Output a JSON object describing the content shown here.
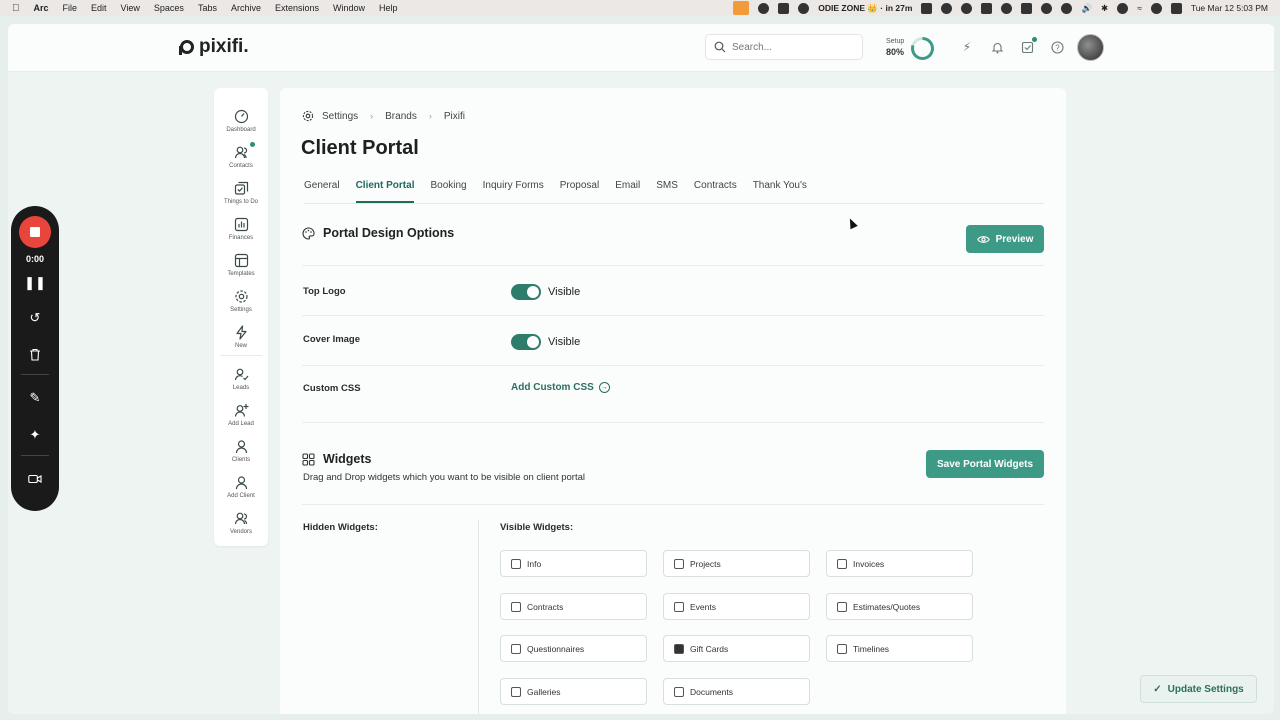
{
  "menubar": {
    "app": "Arc",
    "menus": [
      "File",
      "Edit",
      "View",
      "Spaces",
      "Tabs",
      "Archive",
      "Extensions",
      "Window",
      "Help"
    ],
    "status": "ODIE ZONE 👑 · in 27m",
    "datetime": "Tue Mar 12  5:03 PM"
  },
  "topbar": {
    "brand": "pixifi.",
    "search_placeholder": "Search...",
    "setup_label": "Setup",
    "setup_percent": "80%",
    "setup_progress": 0.8
  },
  "sidebar": {
    "items": [
      {
        "label": "Dashboard",
        "icon": "gauge-icon"
      },
      {
        "label": "Contacts",
        "icon": "contacts-icon"
      },
      {
        "label": "Things to Do",
        "icon": "checklist-icon"
      },
      {
        "label": "Finances",
        "icon": "chart-icon"
      },
      {
        "label": "Templates",
        "icon": "template-icon"
      },
      {
        "label": "Settings",
        "icon": "gear-icon"
      },
      {
        "label": "New",
        "icon": "bolt-icon"
      },
      {
        "label": "Leads",
        "icon": "leads-icon"
      },
      {
        "label": "Add Lead",
        "icon": "add-lead-icon"
      },
      {
        "label": "Clients",
        "icon": "clients-icon"
      },
      {
        "label": "Add Client",
        "icon": "add-client-icon"
      },
      {
        "label": "Vendors",
        "icon": "vendors-icon"
      }
    ]
  },
  "breadcrumb": [
    "Settings",
    "Brands",
    "Pixifi"
  ],
  "page_title": "Client Portal",
  "tabs": [
    "General",
    "Client Portal",
    "Booking",
    "Inquiry Forms",
    "Proposal",
    "Email",
    "SMS",
    "Contracts",
    "Thank You's"
  ],
  "active_tab": "Client Portal",
  "design": {
    "title": "Portal Design Options",
    "preview_label": "Preview",
    "rows": [
      {
        "label": "Top Logo",
        "state": "Visible"
      },
      {
        "label": "Cover Image",
        "state": "Visible"
      }
    ],
    "custom_css_label": "Custom CSS",
    "custom_css_link": "Add Custom CSS"
  },
  "widgets": {
    "title": "Widgets",
    "subtitle": "Drag and Drop widgets which you want to be visible on client portal",
    "save_label": "Save Portal Widgets",
    "hidden_label": "Hidden Widgets:",
    "visible_label": "Visible Widgets:",
    "visible": [
      "Info",
      "Projects",
      "Invoices",
      "Contracts",
      "Events",
      "Estimates/Quotes",
      "Questionnaires",
      "Gift Cards",
      "Timelines",
      "Galleries",
      "Documents"
    ]
  },
  "recorder": {
    "time": "0:00"
  },
  "update_label": "Update Settings",
  "colors": {
    "accent": "#3d9a86",
    "accent_dark": "#1f6b5c",
    "record": "#e8453c"
  }
}
